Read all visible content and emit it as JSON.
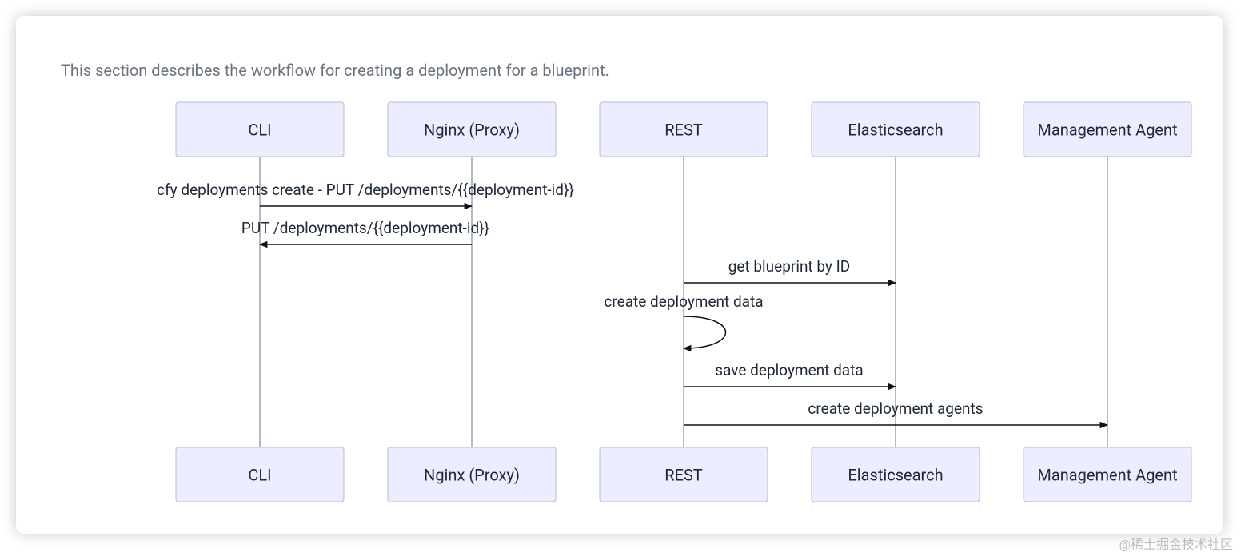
{
  "description": "This section describes the workflow for creating a deployment for a blueprint.",
  "watermark": "@稀土掘金技术社区",
  "actors": {
    "cli": "CLI",
    "nginx": "Nginx (Proxy)",
    "rest": "REST",
    "es": "Elasticsearch",
    "mgmt": "Management Agent"
  },
  "messages": {
    "m1": "cfy deployments create - PUT /deployments/{{deployment-id}}",
    "m2": "PUT /deployments/{{deployment-id}}",
    "m3": "get blueprint by ID",
    "m4": "create deployment data",
    "m5": "save deployment data",
    "m6": "create deployment agents"
  },
  "chart_data": {
    "type": "sequence-diagram",
    "participants": [
      "CLI",
      "Nginx (Proxy)",
      "REST",
      "Elasticsearch",
      "Management Agent"
    ],
    "messages": [
      {
        "from": "CLI",
        "to": "Nginx (Proxy)",
        "label": "cfy deployments create - PUT /deployments/{{deployment-id}}"
      },
      {
        "from": "Nginx (Proxy)",
        "to": "CLI",
        "label": "PUT /deployments/{{deployment-id}}"
      },
      {
        "from": "REST",
        "to": "Elasticsearch",
        "label": "get blueprint by ID"
      },
      {
        "from": "REST",
        "to": "REST",
        "label": "create deployment data"
      },
      {
        "from": "REST",
        "to": "Elasticsearch",
        "label": "save deployment data"
      },
      {
        "from": "REST",
        "to": "Management Agent",
        "label": "create deployment agents"
      }
    ]
  }
}
